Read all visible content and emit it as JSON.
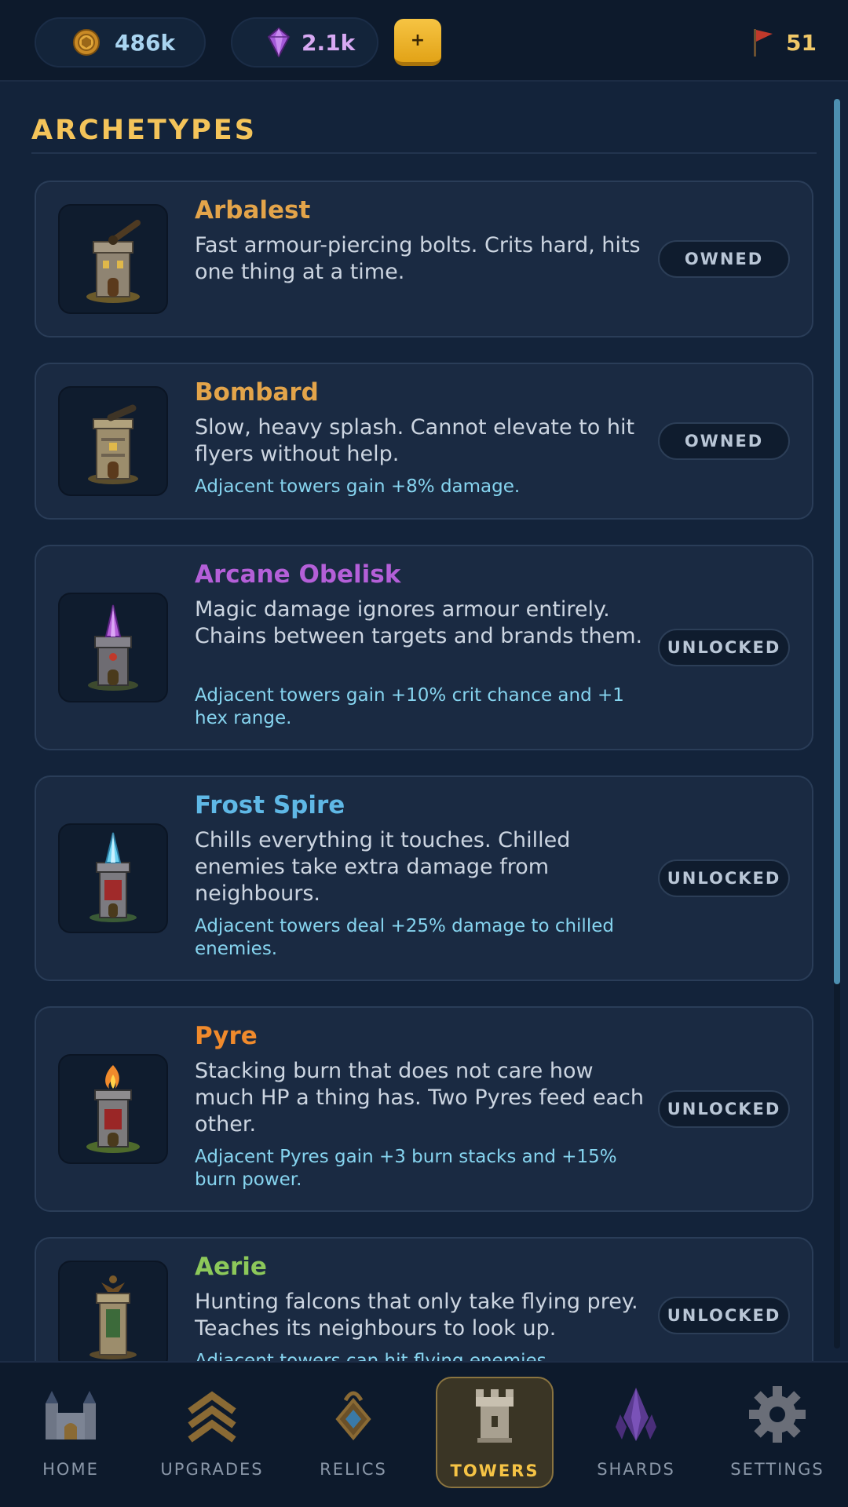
{
  "currency": {
    "coins": "486k",
    "gems": "2.1k",
    "add_label": "+",
    "wave": "51"
  },
  "section": {
    "title": "ARCHETYPES"
  },
  "towers": [
    {
      "name": "Arbalest",
      "name_color": "#e3a44a",
      "description": "Fast armour-piercing bolts. Crits hard, hits one thing at a time.",
      "bonus": "",
      "status": "OWNED",
      "icon": "arbalest-tower-icon"
    },
    {
      "name": "Bombard",
      "name_color": "#e3a44a",
      "description": "Slow, heavy splash. Cannot elevate to hit flyers without help.",
      "bonus": "Adjacent towers gain +8% damage.",
      "status": "OWNED",
      "icon": "bombard-tower-icon"
    },
    {
      "name": "Arcane Obelisk",
      "name_color": "#b45fd8",
      "description": "Magic damage ignores armour entirely. Chains between targets and brands them.",
      "bonus": "Adjacent towers gain +10% crit chance and +1 hex range.",
      "status": "UNLOCKED",
      "icon": "arcane-obelisk-tower-icon"
    },
    {
      "name": "Frost Spire",
      "name_color": "#5fb8e6",
      "description": "Chills everything it touches. Chilled enemies take extra damage from neighbours.",
      "bonus": "Adjacent towers deal +25% damage to chilled enemies.",
      "status": "UNLOCKED",
      "icon": "frost-spire-tower-icon"
    },
    {
      "name": "Pyre",
      "name_color": "#f08a2c",
      "description": "Stacking burn that does not care how much HP a thing has. Two Pyres feed each other.",
      "bonus": "Adjacent Pyres gain +3 burn stacks and +15% burn power.",
      "status": "UNLOCKED",
      "icon": "pyre-tower-icon"
    },
    {
      "name": "Aerie",
      "name_color": "#8cc85a",
      "description": "Hunting falcons that only take flying prey. Teaches its neighbours to look up.",
      "bonus": "Adjacent towers can hit flying enemies.",
      "status": "UNLOCKED",
      "icon": "aerie-tower-icon"
    }
  ],
  "nav": [
    {
      "label": "HOME",
      "icon": "castle-icon",
      "active": false
    },
    {
      "label": "UPGRADES",
      "icon": "chevrons-up-icon",
      "active": false
    },
    {
      "label": "RELICS",
      "icon": "amulet-icon",
      "active": false
    },
    {
      "label": "TOWERS",
      "icon": "tower-icon",
      "active": true
    },
    {
      "label": "SHARDS",
      "icon": "crystal-icon",
      "active": false
    },
    {
      "label": "SETTINGS",
      "icon": "gear-icon",
      "active": false
    }
  ],
  "colors": {
    "accent": "#f4c45a",
    "bonus_text": "#86d4ef",
    "card_bg": "#1a2a42",
    "page_bg": "#13233a"
  }
}
